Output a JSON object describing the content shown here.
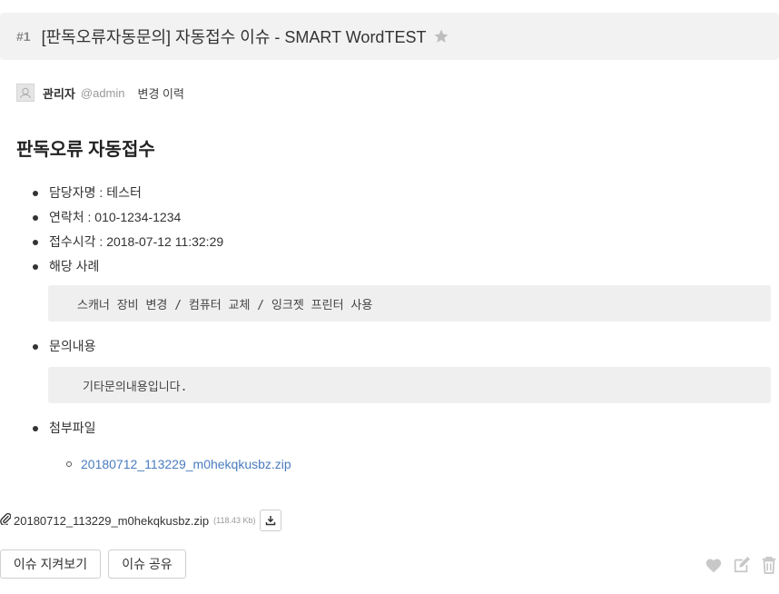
{
  "header": {
    "issue_number": "#1",
    "title": "[판독오류자동문의] 자동접수 이슈 - SMART WordTEST"
  },
  "author": {
    "name": "관리자",
    "handle": "@admin",
    "history_label": "변경 이력"
  },
  "content": {
    "title": "판독오류 자동접수",
    "items": [
      "담당자명 : 테스터",
      "연락처 : 010-1234-1234",
      "접수시각 : 2018-07-12 11:32:29",
      "해당 사례",
      "문의내용",
      "첨부파일"
    ],
    "case_text": "스캐너 장비 변경 / 컴퓨터 교체 / 잉크젯 프린터 사용",
    "inquiry_text": "기타문의내용입니다.",
    "attachment_link": "20180712_113229_m0hekqkusbz.zip"
  },
  "attachment": {
    "file_name": "20180712_113229_m0hekqkusbz.zip",
    "file_size": "(118.43 Kb)"
  },
  "buttons": {
    "watch": "이슈 지켜보기",
    "share": "이슈 공유"
  },
  "icons": {
    "star": "star-icon",
    "avatar": "user-icon",
    "attachment": "paperclip-icon",
    "download": "download-icon",
    "like": "heart-icon",
    "edit": "edit-icon",
    "delete": "trash-icon"
  },
  "colors": {
    "link": "#4a7cc0",
    "header_bg": "#f2f2f2",
    "code_bg": "#efefef",
    "icon_gray": "#c8c8c8"
  }
}
